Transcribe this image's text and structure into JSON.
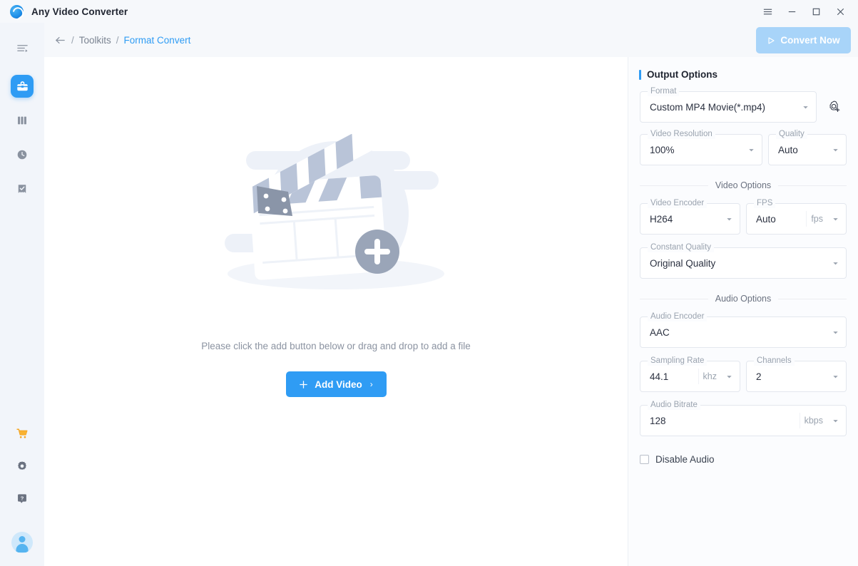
{
  "window": {
    "app_title": "Any Video Converter",
    "logo_icon": "avc-logo-icon",
    "controls": [
      {
        "name": "menu-button",
        "icon": "hamburger-icon"
      },
      {
        "name": "minimize-button",
        "icon": "minimize-icon"
      },
      {
        "name": "maximize-button",
        "icon": "maximize-icon"
      },
      {
        "name": "close-button",
        "icon": "close-icon"
      }
    ]
  },
  "sidebar": {
    "toggle_icon": "collapse-menu-icon",
    "items": [
      {
        "name": "sidebar-item-toolkits",
        "icon": "toolbox-icon",
        "active": true
      },
      {
        "name": "sidebar-item-library",
        "icon": "books-icon",
        "active": false
      },
      {
        "name": "sidebar-item-history",
        "icon": "clock-icon",
        "active": false
      },
      {
        "name": "sidebar-item-tasks",
        "icon": "checklist-icon",
        "active": false
      }
    ],
    "bottom_items": [
      {
        "name": "sidebar-item-store",
        "icon": "shopping-cart-icon"
      },
      {
        "name": "sidebar-item-settings",
        "icon": "gear-icon"
      },
      {
        "name": "sidebar-item-help",
        "icon": "help-icon"
      }
    ],
    "avatar": "user-avatar"
  },
  "breadcrumb": {
    "back_icon": "back-arrow-icon",
    "sep1": "/",
    "root": "Toolkits",
    "sep2": "/",
    "current": "Format Convert"
  },
  "toolbar": {
    "convert_label": "Convert Now",
    "convert_icon": "play-triangle-icon",
    "convert_disabled": true,
    "convert_color": "#a8d4f9"
  },
  "stage": {
    "illustration": "clapperboard-add-illustration",
    "hint": "Please click the add button below or drag and drop to add a file",
    "add_label": "Add Video",
    "add_plus_icon": "plus-icon",
    "add_chevron_icon": "chevron-right-icon",
    "add_color": "#2f9cf4"
  },
  "output_options": {
    "title": "Output Options",
    "accent": "#2f9cf4",
    "format": {
      "label": "Format",
      "value": "Custom MP4 Movie(*.mp4)",
      "caret_icon": "chevron-down-icon"
    },
    "preset_button": {
      "name": "add-preset-button",
      "icon": "gear-plus-icon"
    },
    "video_resolution": {
      "label": "Video Resolution",
      "value": "100%",
      "caret_icon": "chevron-down-icon"
    },
    "quality": {
      "label": "Quality",
      "value": "Auto",
      "caret_icon": "chevron-down-icon"
    },
    "video_section": "Video Options",
    "video_encoder": {
      "label": "Video Encoder",
      "value": "H264",
      "caret_icon": "chevron-down-icon"
    },
    "fps": {
      "label": "FPS",
      "value": "Auto",
      "unit": "fps",
      "caret_icon": "chevron-down-icon"
    },
    "constant_quality": {
      "label": "Constant Quality",
      "value": "Original Quality",
      "caret_icon": "chevron-down-icon"
    },
    "audio_section": "Audio Options",
    "audio_encoder": {
      "label": "Audio Encoder",
      "value": "AAC",
      "caret_icon": "chevron-down-icon"
    },
    "sampling_rate": {
      "label": "Sampling Rate",
      "value": "44.1",
      "unit": "khz",
      "caret_icon": "chevron-down-icon"
    },
    "channels": {
      "label": "Channels",
      "value": "2",
      "caret_icon": "chevron-down-icon"
    },
    "audio_bitrate": {
      "label": "Audio Bitrate",
      "value": "128",
      "unit": "kbps",
      "caret_icon": "chevron-down-icon"
    },
    "disable_audio": {
      "label": "Disable Audio",
      "checked": false
    }
  }
}
